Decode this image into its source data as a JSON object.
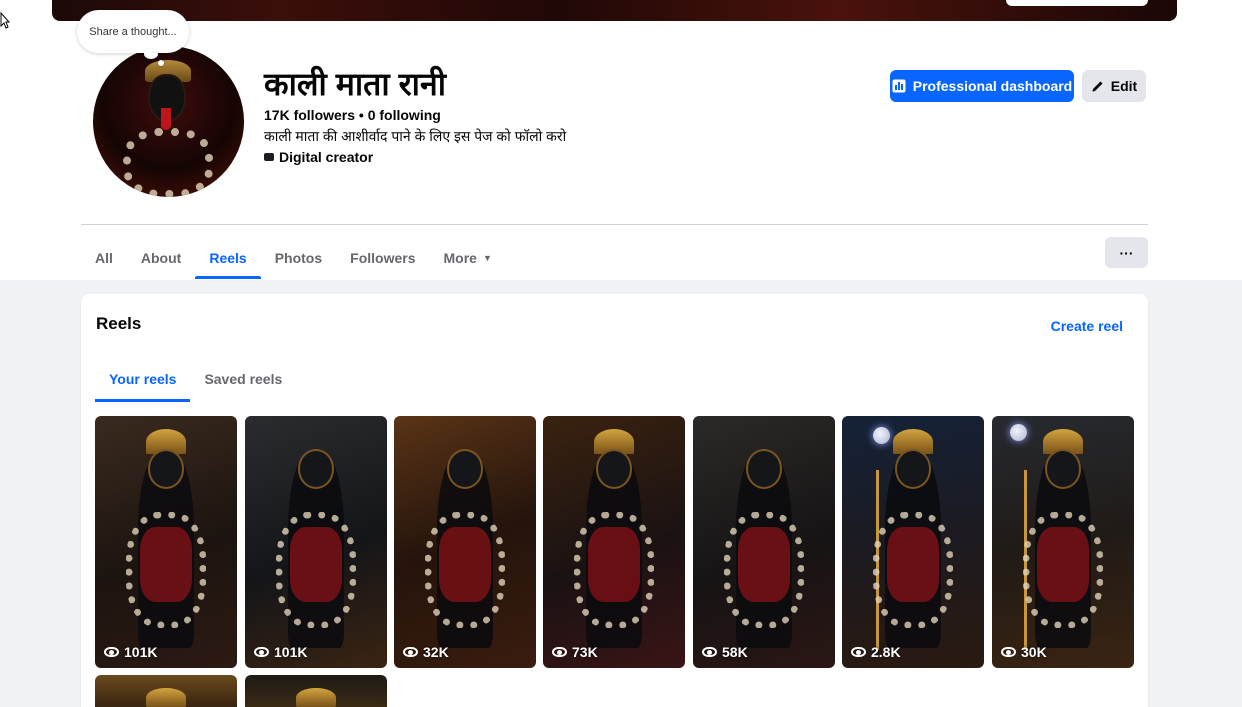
{
  "profile": {
    "name": "काली माता रानी",
    "counts": "17K followers • 0 following",
    "bio": "काली माता की आशीर्वाद पाने के लिए इस पेज को फॉलो करो",
    "category": "Digital creator",
    "thought_bubble": "Share a thought..."
  },
  "actions": {
    "pro_dashboard": "Professional dashboard",
    "edit": "Edit",
    "more": "···"
  },
  "tabs": [
    {
      "label": "All"
    },
    {
      "label": "About"
    },
    {
      "label": "Reels",
      "active": true
    },
    {
      "label": "Photos"
    },
    {
      "label": "Followers"
    },
    {
      "label": "More"
    }
  ],
  "reels_section": {
    "title": "Reels",
    "create": "Create reel",
    "subtabs": [
      {
        "label": "Your reels",
        "active": true
      },
      {
        "label": "Saved reels"
      }
    ],
    "items": [
      {
        "views": "101K"
      },
      {
        "views": "101K"
      },
      {
        "views": "32K"
      },
      {
        "views": "73K"
      },
      {
        "views": "58K"
      },
      {
        "views": "2.8K"
      },
      {
        "views": "30K"
      }
    ]
  },
  "colors": {
    "accent": "#0866ff",
    "page_bg": "#f0f2f5",
    "secondary_button": "#e4e6eb"
  }
}
